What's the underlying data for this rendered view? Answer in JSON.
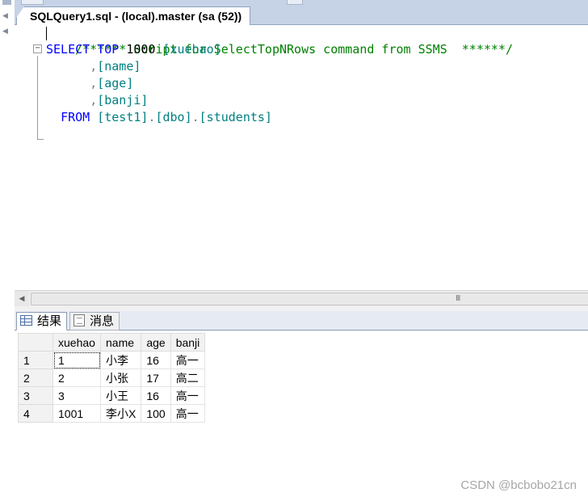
{
  "document_tab": {
    "title": "SQLQuery1.sql - (local).master (sa (52))"
  },
  "editor": {
    "lines": {
      "comment": "/****** Script for SelectTopNRows command from SSMS  ******/",
      "select_kw": "SELECT",
      "top_kw": "TOP",
      "top_n": "1000",
      "col1": "[xuehao]",
      "col2": "[name]",
      "col3": "[age]",
      "col4": "[banji]",
      "from_kw": "FROM",
      "tbl_db": "[test1]",
      "tbl_schema": "[dbo]",
      "tbl_name": "[students]",
      "comma": ",",
      "dot": "."
    },
    "collapse_symbol": "−"
  },
  "scrollbar": {
    "grip": "III"
  },
  "results_tabs": [
    {
      "label": "结果"
    },
    {
      "label": "消息"
    }
  ],
  "grid": {
    "columns": [
      "xuehao",
      "name",
      "age",
      "banji"
    ],
    "rows": [
      {
        "num": "1",
        "cells": [
          "1",
          "小李",
          "16",
          "高一"
        ]
      },
      {
        "num": "2",
        "cells": [
          "2",
          "小张",
          "17",
          "高二"
        ]
      },
      {
        "num": "3",
        "cells": [
          "3",
          "小王",
          "16",
          "高一"
        ]
      },
      {
        "num": "4",
        "cells": [
          "1001",
          "李小X",
          "100",
          "高一"
        ]
      }
    ]
  },
  "watermark": "CSDN @bcbobo21cn",
  "colors": {
    "keyword": "#0000ff",
    "comment": "#008000",
    "identifier": "#008080",
    "tab_bar": "#c6d3e6"
  }
}
